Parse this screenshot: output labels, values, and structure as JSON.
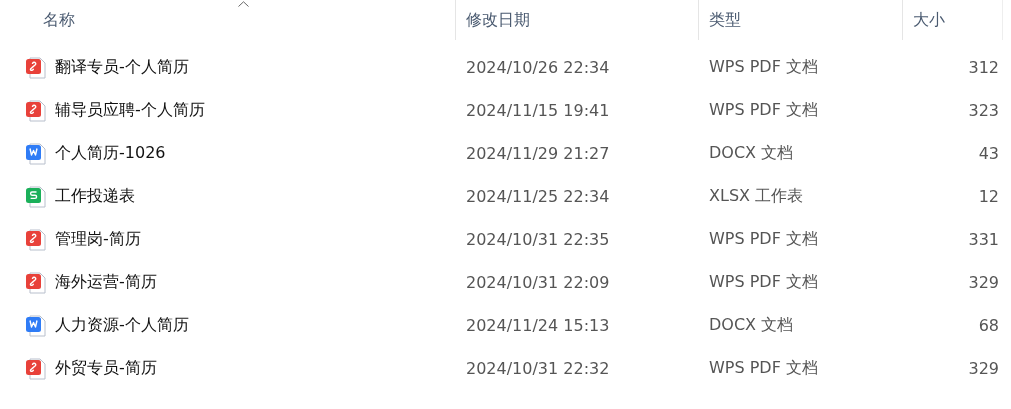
{
  "table": {
    "columns": [
      "名称",
      "修改日期",
      "类型",
      "大小"
    ],
    "rows": [
      {
        "kind": "pdf",
        "name": "翻译专员-个人简历",
        "modified": "2024/10/26 22:34",
        "type": "WPS PDF 文档",
        "size": "312"
      },
      {
        "kind": "pdf",
        "name": "辅导员应聘-个人简历",
        "modified": "2024/11/15 19:41",
        "type": "WPS PDF 文档",
        "size": "323"
      },
      {
        "kind": "docx",
        "name": "个人简历-1026",
        "modified": "2024/11/29 21:27",
        "type": "DOCX 文档",
        "size": "43"
      },
      {
        "kind": "xlsx",
        "name": "工作投递表",
        "modified": "2024/11/25 22:34",
        "type": "XLSX 工作表",
        "size": "12"
      },
      {
        "kind": "pdf",
        "name": "管理岗-简历",
        "modified": "2024/10/31 22:35",
        "type": "WPS PDF 文档",
        "size": "331"
      },
      {
        "kind": "pdf",
        "name": "海外运营-简历",
        "modified": "2024/10/31 22:09",
        "type": "WPS PDF 文档",
        "size": "329"
      },
      {
        "kind": "docx",
        "name": "人力资源-个人简历",
        "modified": "2024/11/24 15:13",
        "type": "DOCX 文档",
        "size": "68"
      },
      {
        "kind": "pdf",
        "name": "外贸专员-简历",
        "modified": "2024/10/31 22:32",
        "type": "WPS PDF 文档",
        "size": "329"
      }
    ]
  }
}
